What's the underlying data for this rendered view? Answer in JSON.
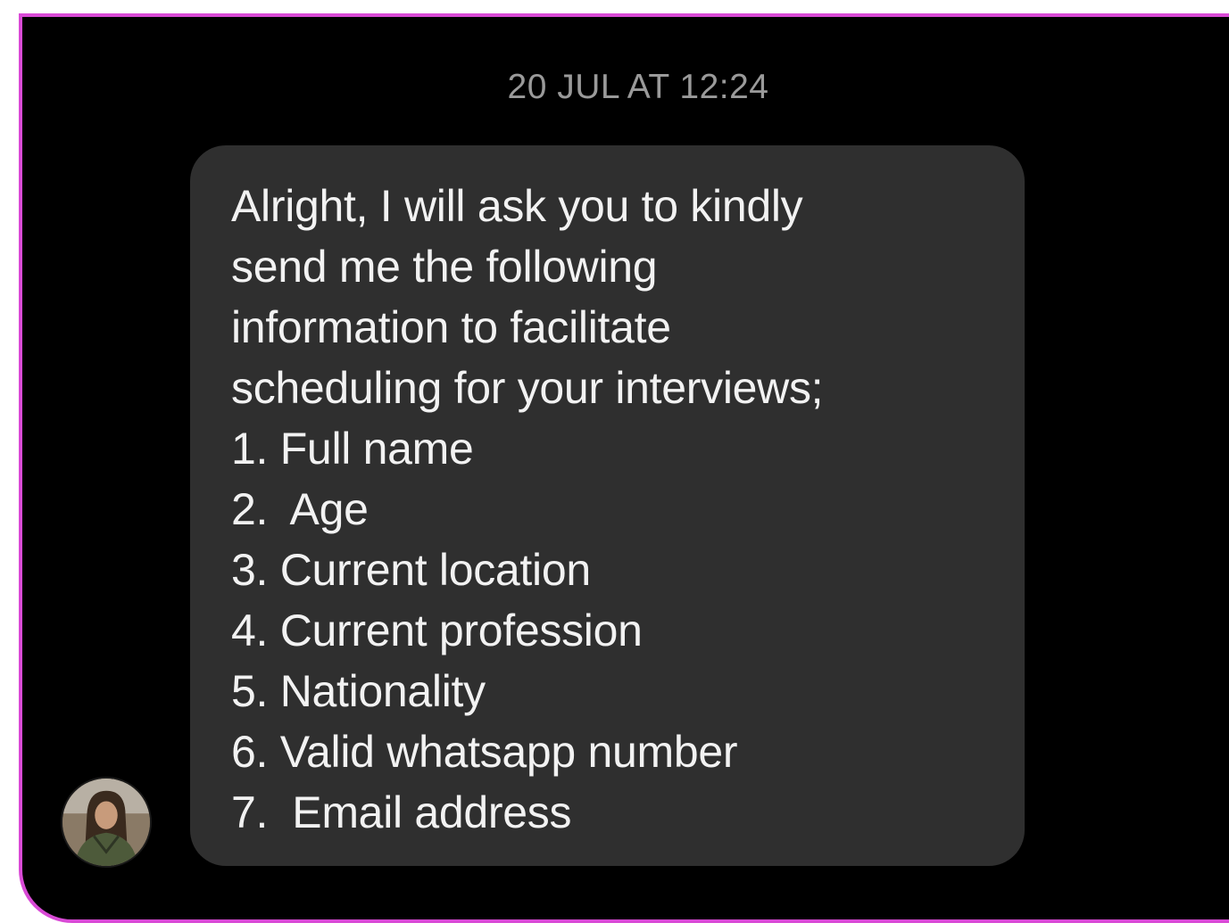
{
  "chat": {
    "timestamp": "20 JUL AT 12:24",
    "message": {
      "lines": [
        "Alright, I will ask you to kindly",
        "send me the following",
        "information to facilitate",
        "scheduling for your interviews;",
        "1. Full name",
        "2.  Age",
        "3. Current location",
        "4. Current profession",
        "5. Nationality",
        "6. Valid whatsapp number",
        "7.  Email address"
      ]
    },
    "sender_avatar": {
      "icon": "user-avatar-photo"
    }
  },
  "colors": {
    "frame_border": "#d94ad6",
    "background": "#000000",
    "bubble": "#2f2f2f",
    "message_text": "#f2f2f2",
    "timestamp_text": "#9a9a9a"
  }
}
